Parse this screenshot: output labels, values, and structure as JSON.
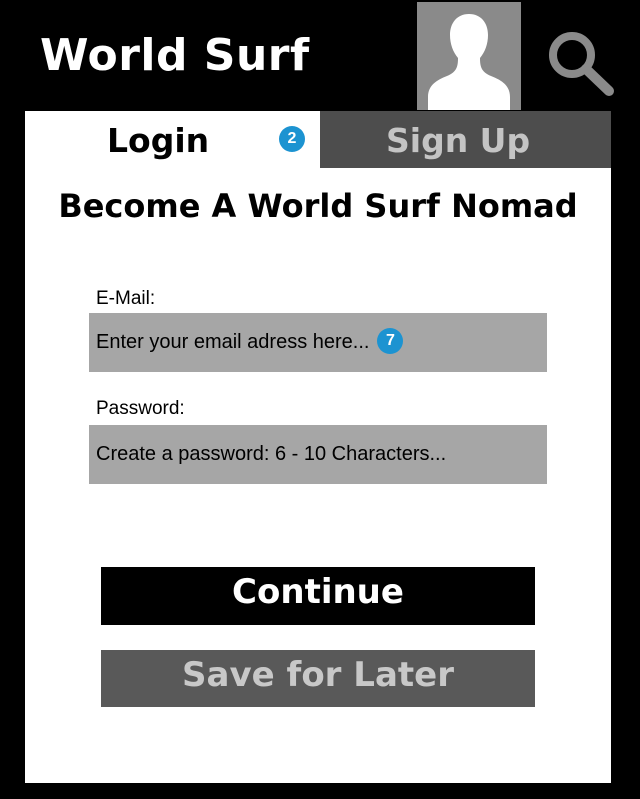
{
  "header": {
    "app_title": "World Surf"
  },
  "icons": {
    "avatar": "user-avatar-icon",
    "search": "search-icon"
  },
  "tabs": [
    {
      "label": "Login",
      "active": true
    },
    {
      "label": "Sign Up",
      "active": false
    }
  ],
  "annotations": {
    "tab_badge": "2",
    "email_badge": "7"
  },
  "form": {
    "heading": "Become A World Surf Nomad",
    "email": {
      "label": "E-Mail:",
      "placeholder": "Enter your email adress here..."
    },
    "password": {
      "label": "Password:",
      "placeholder": "Create a password: 6 - 10 Characters..."
    }
  },
  "buttons": {
    "continue_label": "Continue",
    "save_label": "Save for Later"
  },
  "colors": {
    "background": "#000000",
    "panel": "#ffffff",
    "input_fill": "#a6a6a6",
    "inactive_tab": "#4d4d4d",
    "save_button": "#595959",
    "badge": "#1c93d1"
  }
}
